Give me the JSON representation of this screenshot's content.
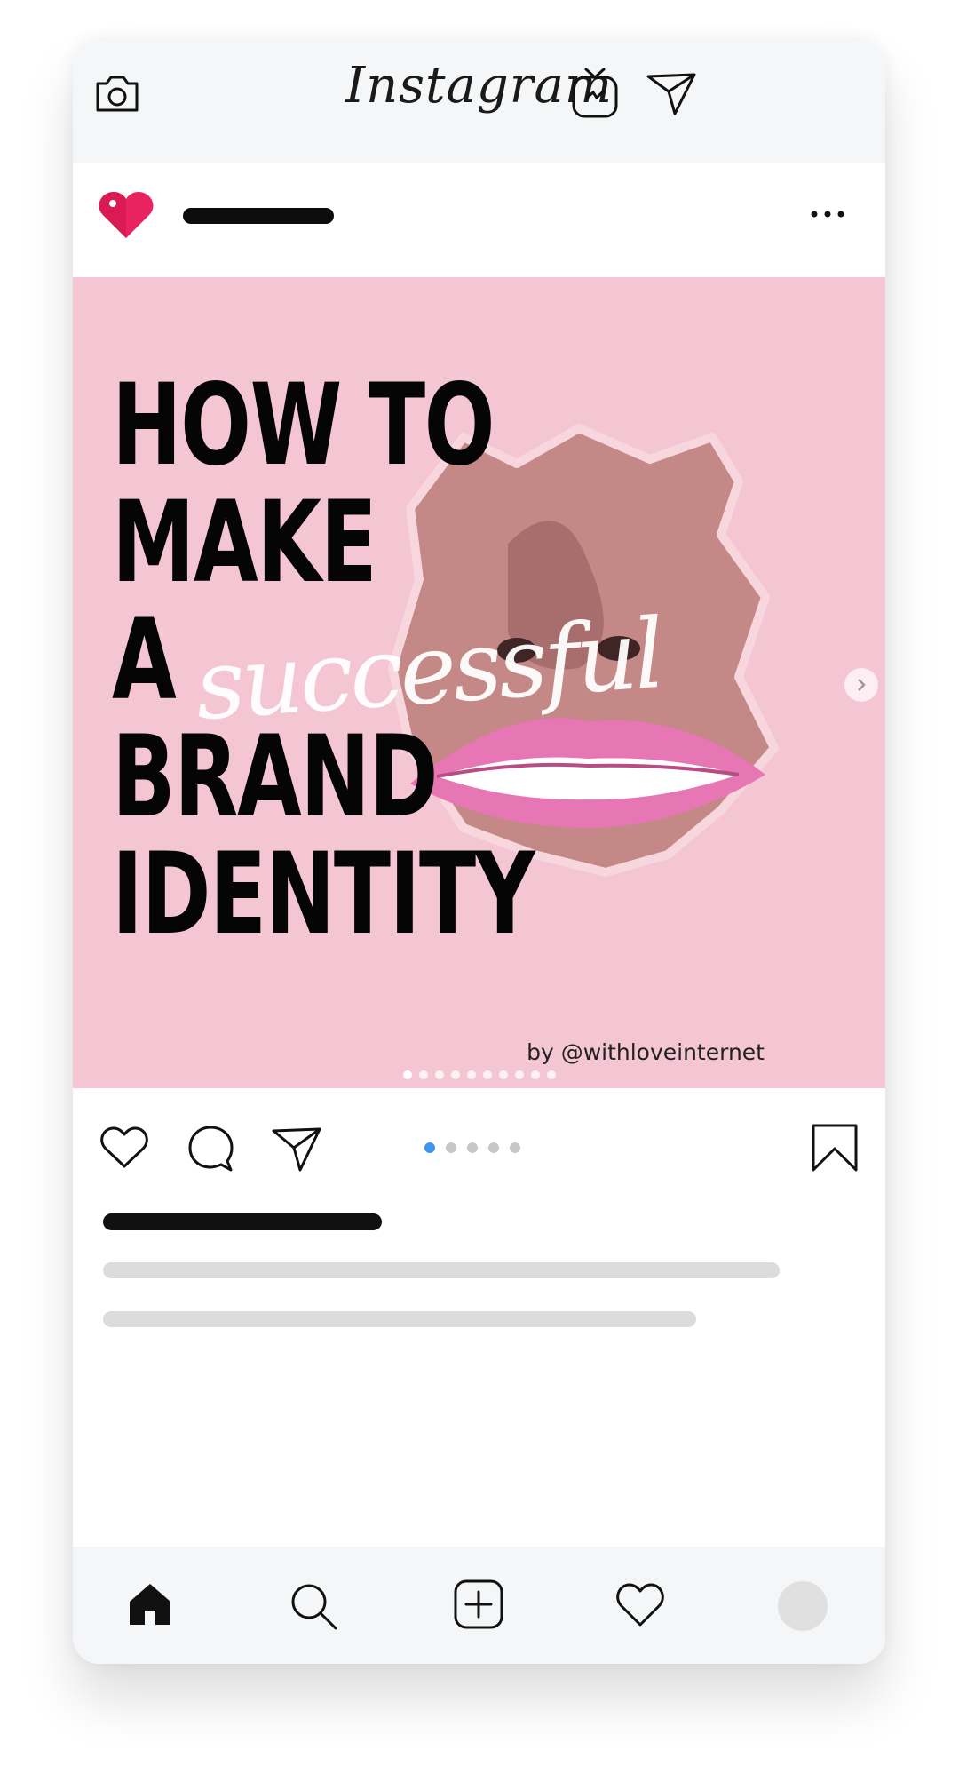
{
  "app": {
    "title": "Instagram"
  },
  "topbar": {
    "camera_icon": "camera-icon",
    "igtv_icon": "igtv-icon",
    "direct_icon": "paper-plane-icon"
  },
  "post": {
    "avatar_icon": "heart-badge-icon",
    "more_icon": "more-options-icon",
    "image": {
      "headline_lines": [
        "HOW TO",
        "MAKE",
        "A",
        "BRAND",
        "IDENTITY"
      ],
      "script_word": "successful",
      "credit": "by @withloveinternet",
      "slide_count": 10,
      "active_slide": 0
    },
    "actions": {
      "like_icon": "heart-outline-icon",
      "comment_icon": "comment-icon",
      "share_icon": "paper-plane-icon",
      "save_icon": "bookmark-icon"
    },
    "pagination": {
      "count": 5,
      "active": 0
    }
  },
  "bottom_nav": {
    "items": [
      "home-icon",
      "search-icon",
      "add-post-icon",
      "activity-heart-icon",
      "profile-avatar"
    ]
  },
  "colors": {
    "accent_pink": "#e8235f",
    "image_background": "#f4c6d3",
    "active_dot": "#3d97f0",
    "placeholder_dark": "#111111",
    "placeholder_light": "#dcdcdc"
  }
}
